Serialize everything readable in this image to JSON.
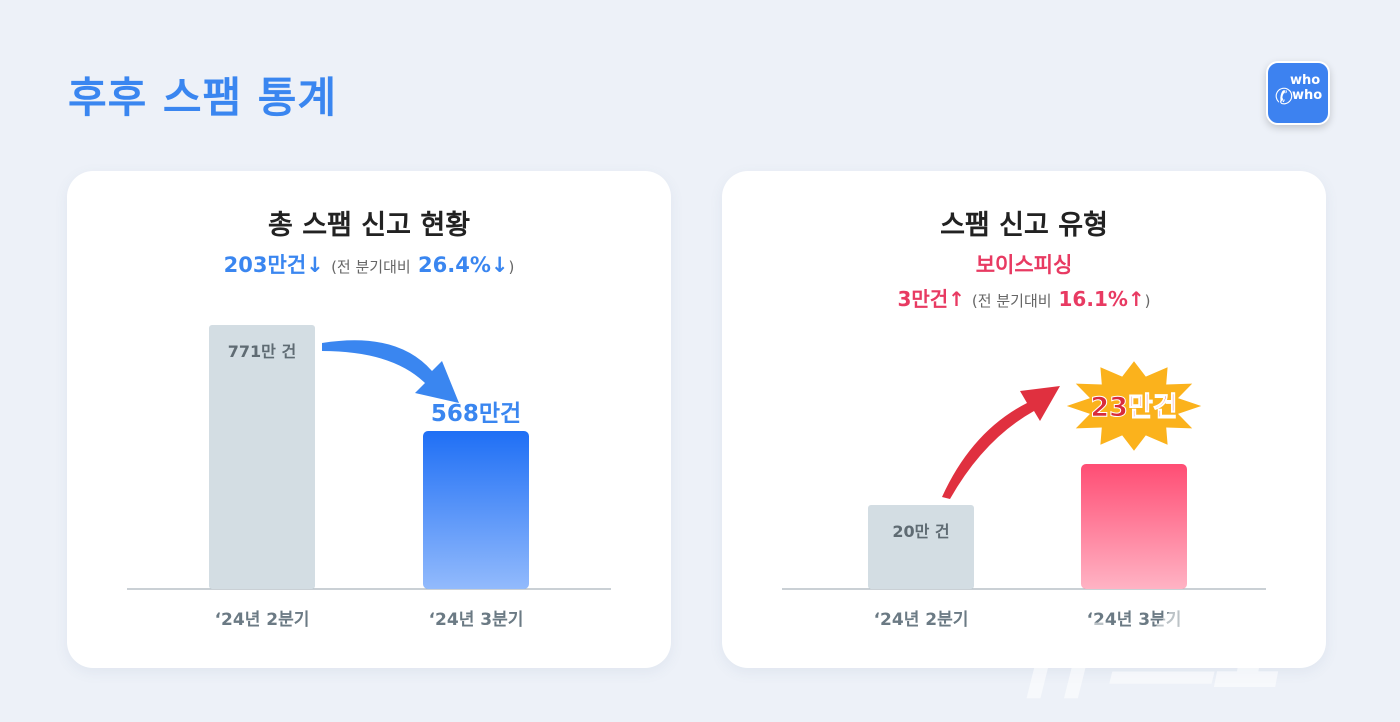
{
  "page_title": "후후 스팸 통계",
  "logo": {
    "line1": "who",
    "line2": "who",
    "icon": "phone-icon",
    "color": "#3d82f0"
  },
  "watermark": "뉴스1",
  "chart_data": [
    {
      "type": "bar",
      "title": "총 스팸 신고 현황",
      "subtitle": {
        "amount": "203만건↓",
        "paren_open": "(전 분기대비",
        "pct": "26.4%↓",
        "paren_close": ")"
      },
      "categories": [
        "‘24년 2분기",
        "‘24년 3분기"
      ],
      "values": [
        771,
        568
      ],
      "data_labels": [
        "771만 건",
        "568만건"
      ],
      "unit": "만건",
      "colors": [
        "#d3dde3",
        "#1f6ff5"
      ],
      "accent": "#3a86f0"
    },
    {
      "type": "bar",
      "title": "스팸 신고 유형",
      "category_label": "보이스피싱",
      "subtitle": {
        "amount": "3만건↑",
        "paren_open": "(전 분기대비",
        "pct": "16.1%↑",
        "paren_close": ")"
      },
      "categories": [
        "‘24년 2분기",
        "‘24년 3분기"
      ],
      "values": [
        20,
        23
      ],
      "data_labels": [
        "20만 건",
        "23만건"
      ],
      "unit": "만건",
      "colors": [
        "#d3dde3",
        "#ff4d74"
      ],
      "accent": "#e83a62"
    }
  ]
}
